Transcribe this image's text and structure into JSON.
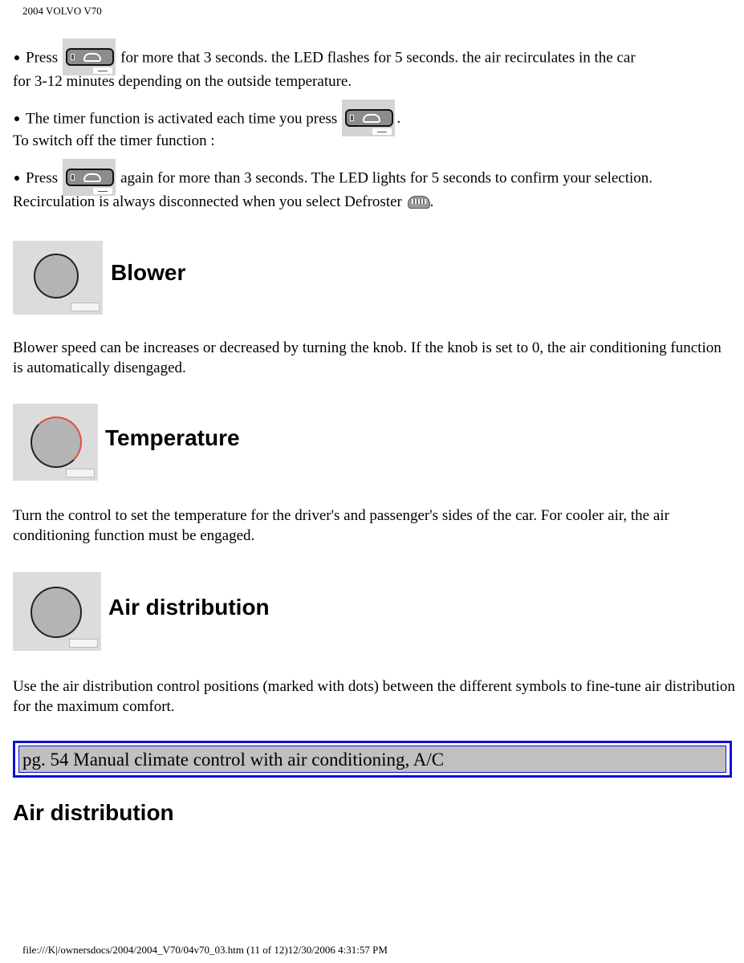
{
  "header": {
    "title": "2004 VOLVO V70"
  },
  "content": {
    "line1_a": "Press",
    "line1_b": "for more that 3 seconds. the LED flashes for 5 seconds. the air recirculates in the car",
    "line2": "for 3-12 minutes depending on the outside temperature.",
    "line3_a": "The timer function is activated each time you press",
    "line3_b": ".",
    "line4": "To switch off the timer function :",
    "line5_a": "Press",
    "line5_b": "again for more than 3 seconds. The LED lights for 5 seconds to confirm your selection.",
    "line6_a": "Recirculation is always disconnected when you select Defroster",
    "line6_b": ".",
    "icons": {
      "recirculation_button": "recirculation-button-icon",
      "defroster": "defroster-icon"
    }
  },
  "sections": [
    {
      "title": "Blower",
      "image": "blower-knob-image",
      "text": "Blower speed can be increases or decreased by turning the knob. If the knob is set to 0, the air conditioning function is automatically disengaged."
    },
    {
      "title": "Temperature",
      "image": "temperature-knob-image",
      "text": "Turn the control to set the temperature for the driver's and passenger's sides of the car. For cooler air, the air conditioning function must be engaged."
    },
    {
      "title": "Air distribution",
      "image": "air-distribution-knob-image",
      "text": "Use the air distribution control positions (marked with dots) between the different symbols to fine-tune air distribution for the maximum comfort."
    }
  ],
  "page_link": {
    "label": "pg. 54 Manual climate control with air conditioning, A/C",
    "border_color": "#1010d8",
    "background": "#c0c0c0"
  },
  "next_heading": "Air distribution",
  "footer": {
    "text": "file:///K|/ownersdocs/2004/2004_V70/04v70_03.htm (11 of 12)12/30/2006 4:31:57 PM"
  }
}
